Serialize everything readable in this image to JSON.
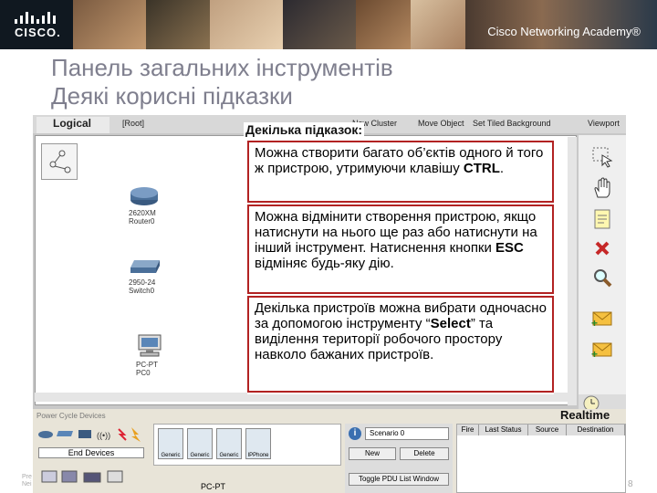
{
  "banner": {
    "logo_text": "CISCO.",
    "academy": "Cisco Networking Academy®"
  },
  "slide": {
    "title_line1": "Панель загальних інструментів",
    "title_line2": "Деякі корисні підказки"
  },
  "toolbar": {
    "logical": "Logical",
    "root": "[Root]",
    "new_cluster": "New Cluster",
    "move_object": "Move Object",
    "set_tiled": "Set Tiled Background",
    "viewport": "Viewport"
  },
  "devices": [
    {
      "model": "2620XM",
      "name": "Router0"
    },
    {
      "model": "2950-24",
      "name": "Switch0"
    },
    {
      "model": "PC-PT",
      "name": "PC0"
    }
  ],
  "callout": {
    "title": "Декілька підказок:",
    "tip1_a": "Можна створити багато об’єктів одного й того ж пристрою, утримуючи клавішу ",
    "tip1_key": "CTRL",
    "tip1_b": ".",
    "tip2_a": "Можна відмінити створення пристрою, якщо натиснути на нього ще раз або натиснути на інший інструмент. Натиснення кнопки ",
    "tip2_key": "ESC",
    "tip2_b": " відміняє будь-яку дію.",
    "tip3_a": "Декілька пристроїв можна вибрати одночасно за допомогою інструменту “",
    "tip3_key": "Select",
    "tip3_b": "” та виділення території робочого простору навколо бажаних пристроїв."
  },
  "bottom": {
    "power_cycle": "Power Cycle Devices",
    "realtime": "Realtime",
    "end_devices": "End Devices",
    "device_buttons": [
      "Generic",
      "Generic",
      "Generic",
      "IPPhone"
    ],
    "selected_device": "PC-PT",
    "scenario": "Scenario 0",
    "new": "New",
    "delete": "Delete",
    "toggle_pdu": "Toggle PDU List Window",
    "pdu_headers": [
      "Fire",
      "Last Status",
      "Source",
      "Destination"
    ]
  },
  "footer": {
    "left_line1": "Pre",
    "left_line2": "Nei",
    "page": "8"
  },
  "colors": {
    "tip_border": "#b22222",
    "title": "#7f7f8e",
    "banner": "#1a2b3c"
  },
  "icons": [
    "select-icon",
    "move-hand-icon",
    "note-icon",
    "delete-x-icon",
    "inspect-magnifier-icon",
    "add-simple-pdu-icon",
    "add-complex-pdu-icon",
    "realtime-clock-icon"
  ]
}
